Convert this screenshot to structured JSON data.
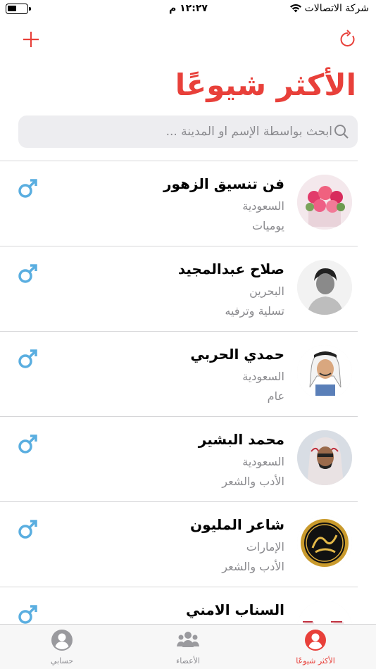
{
  "status_bar": {
    "carrier": "شركة الاتصالات",
    "time": "١٢:٢٧ م"
  },
  "header": {
    "title": "الأكثر شيوعًا"
  },
  "search": {
    "placeholder": "ابحث بواسطة الإسم او المدينة ..."
  },
  "accent_color": "#e8403a",
  "gender_icon_color": "#5aaee0",
  "members": [
    {
      "name": "فن تنسيق الزهور",
      "country": "السعودية",
      "category": "يوميات",
      "avatar": "flowers"
    },
    {
      "name": "صلاح عبدالمجيد",
      "country": "البحرين",
      "category": "تسلية وترفيه",
      "avatar": "person-bw"
    },
    {
      "name": "حمدي الحربي",
      "country": "السعودية",
      "category": "عام",
      "avatar": "caricature"
    },
    {
      "name": "محمد البشير",
      "country": "السعودية",
      "category": "الأدب والشعر",
      "avatar": "person-ghutra"
    },
    {
      "name": "شاعر المليون",
      "country": "الإمارات",
      "category": "الأدب والشعر",
      "avatar": "gold-logo"
    },
    {
      "name": "السناب الامني",
      "country": "",
      "category": "",
      "avatar": "group"
    }
  ],
  "tabbar": {
    "popular": "الأكثر شيوعًا",
    "members": "الأعضاء",
    "account": "حسابي"
  }
}
